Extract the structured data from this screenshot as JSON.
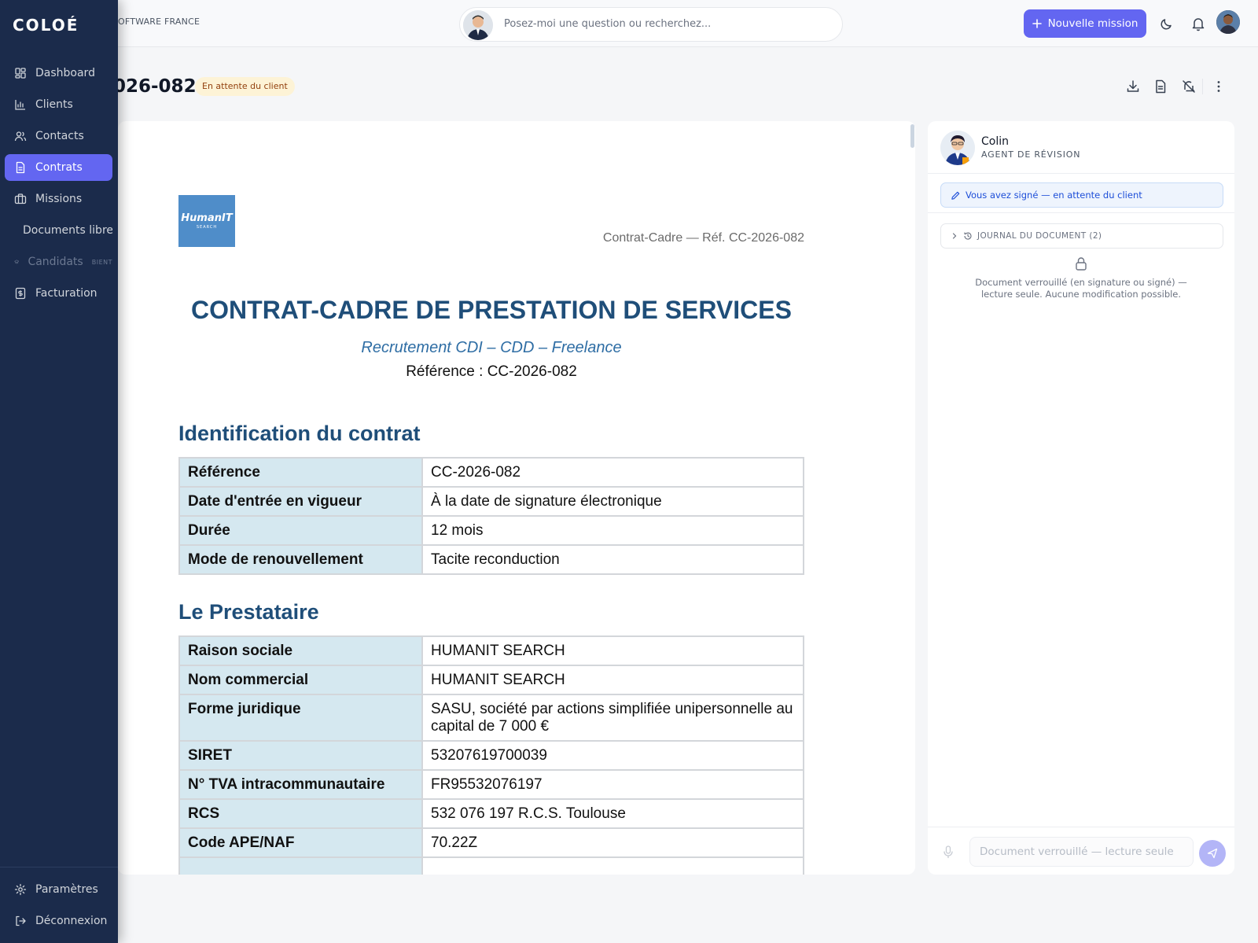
{
  "app": {
    "brand": "COLOÉ",
    "company": "OFTWARE FRANCE"
  },
  "topbar": {
    "search_placeholder": "Posez-moi une question ou recherchez...",
    "new_mission_label": "Nouvelle mission"
  },
  "sidebar": {
    "items": [
      {
        "label": "Dashboard",
        "icon": "dashboard-icon"
      },
      {
        "label": "Clients",
        "icon": "chart-icon"
      },
      {
        "label": "Contacts",
        "icon": "users-icon"
      },
      {
        "label": "Contrats",
        "icon": "document-icon",
        "active": true
      },
      {
        "label": "Missions",
        "icon": "briefcase-icon"
      },
      {
        "label": "Documents libre",
        "icon": "files-icon"
      },
      {
        "label": "Candidats",
        "icon": "graduation-icon",
        "badge": "BIENT",
        "disabled": true
      },
      {
        "label": "Facturation",
        "icon": "invoice-icon"
      }
    ],
    "bottom": [
      {
        "label": "Paramètres",
        "icon": "gear-icon"
      },
      {
        "label": "Déconnexion",
        "icon": "logout-icon"
      }
    ]
  },
  "page": {
    "title": "026-082",
    "status": "En attente du client",
    "status_color": "#fdf3d6"
  },
  "document": {
    "logo_text": "HumanIT",
    "logo_subtext": "SEARCH",
    "header_ref": "Contrat-Cadre — Réf. CC-2026-082",
    "title": "CONTRAT-CADRE DE PRESTATION DE SERVICES",
    "subtitle": "Recrutement CDI – CDD – Freelance",
    "reference_line": "Référence : CC-2026-082",
    "sections": [
      {
        "heading": "Identification du contrat",
        "rows": [
          [
            "Référence",
            "CC-2026-082"
          ],
          [
            "Date d'entrée en vigueur",
            "À la date de signature électronique"
          ],
          [
            "Durée",
            "12 mois"
          ],
          [
            "Mode de renouvellement",
            "Tacite reconduction"
          ]
        ]
      },
      {
        "heading": "Le Prestataire",
        "rows": [
          [
            "Raison sociale",
            "HUMANIT SEARCH"
          ],
          [
            "Nom commercial",
            "HUMANIT SEARCH"
          ],
          [
            "Forme juridique",
            "SASU, société par actions simplifiée unipersonnelle au capital de 7 000 €"
          ],
          [
            "SIRET",
            "53207619700039"
          ],
          [
            "N° TVA intracommunautaire",
            "FR95532076197"
          ],
          [
            "RCS",
            "532 076 197 R.C.S. Toulouse"
          ],
          [
            "Code APE/NAF",
            "70.22Z"
          ],
          [
            "",
            ""
          ]
        ]
      }
    ]
  },
  "panel": {
    "agent_name": "Colin",
    "agent_role": "AGENT DE RÉVISION",
    "notice": "Vous avez signé — en attente du client",
    "journal": "JOURNAL DU DOCUMENT (2)",
    "locked_text": "Document verrouillé (en signature ou signé) — lecture seule. Aucune modification possible.",
    "input_placeholder": "Document verrouillé — lecture seule"
  },
  "colors": {
    "accent": "#6366f1",
    "sidebar": "#1b2b4b",
    "doc_heading": "#1f4e79"
  }
}
